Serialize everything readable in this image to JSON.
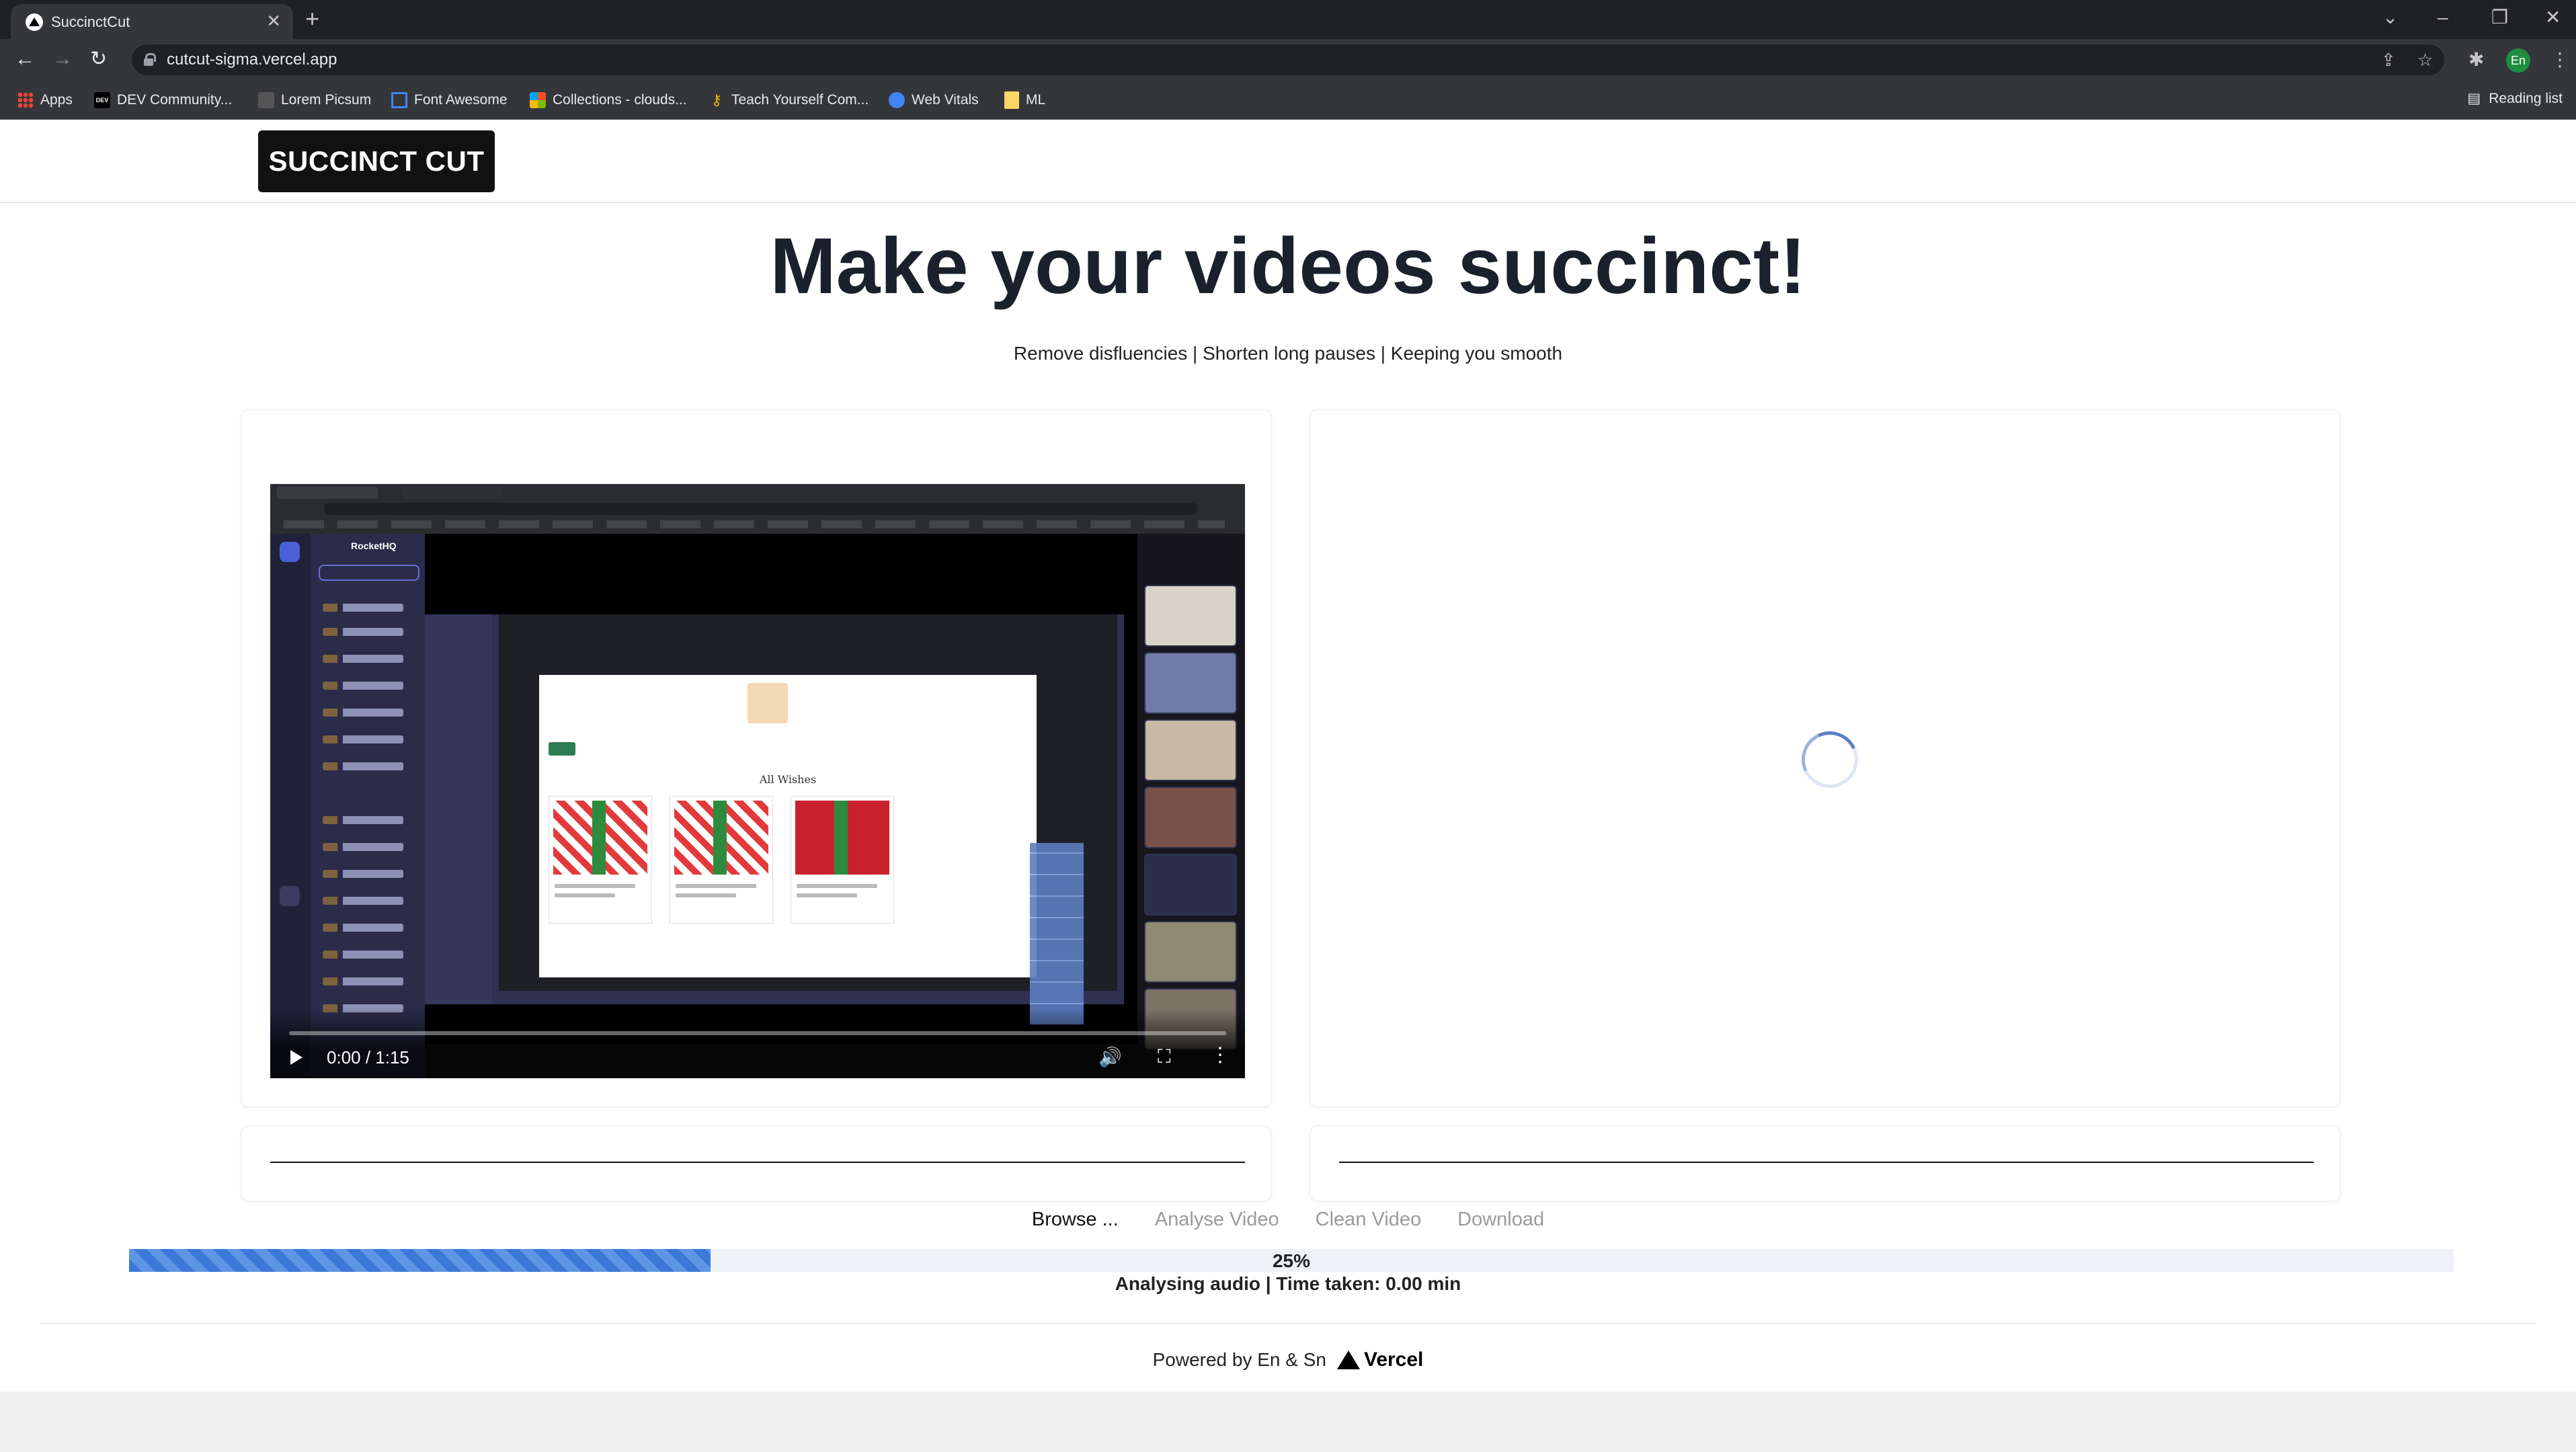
{
  "browser": {
    "tab_title": "SuccinctCut",
    "tab_close": "✕",
    "new_tab": "+",
    "url": "cutcut-sigma.vercel.app",
    "profile_initials": "En",
    "bookmarks": [
      {
        "label": "Apps",
        "icon": "apps-grid-icon"
      },
      {
        "label": "DEV Community...",
        "icon": "dev-icon"
      },
      {
        "label": "Lorem Picsum",
        "icon": "lorem-picsum-icon"
      },
      {
        "label": "Font Awesome",
        "icon": "font-awesome-flag-icon"
      },
      {
        "label": "Collections - clouds...",
        "icon": "microsoft-icon"
      },
      {
        "label": "Teach Yourself Com...",
        "icon": "key-icon"
      },
      {
        "label": "Web Vitals",
        "icon": "web-vitals-icon"
      },
      {
        "label": "ML",
        "icon": "folder-icon"
      }
    ],
    "reading_list": "Reading list"
  },
  "header": {
    "logo": "SUCCINCT CUT"
  },
  "hero": {
    "title": "Make your videos succinct!",
    "subtitle": "Remove disfluencies | Shorten long pauses | Keeping you smooth"
  },
  "video": {
    "time": "0:00 / 1:15",
    "mock_heading": "All Wishes",
    "mock_app_title": "RocketHQ"
  },
  "steps": [
    "Browse ...",
    "Analyse Video",
    "Clean Video",
    "Download"
  ],
  "progress": {
    "percent": 25,
    "label": "25%",
    "status": "Analysing audio | Time taken: 0.00 min"
  },
  "footer": {
    "powered_by": "Powered by En & Sn",
    "brand": "Vercel"
  },
  "colors": {
    "progress_fill": "#3d78d6",
    "logo_bg": "#111111",
    "title": "#1a202c"
  }
}
